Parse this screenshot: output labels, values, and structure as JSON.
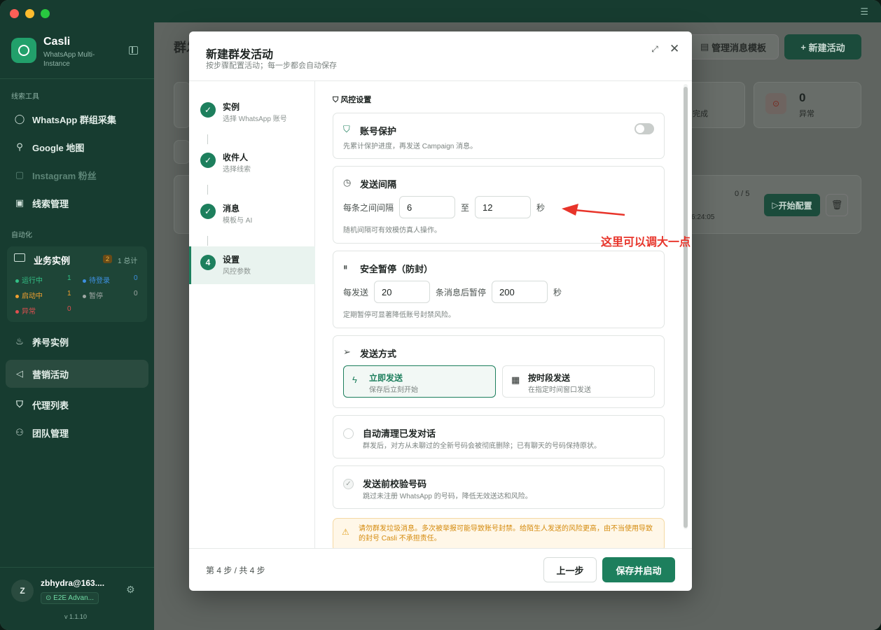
{
  "app": {
    "name": "Casli",
    "subtitle": "WhatsApp Multi-Instance"
  },
  "sidebar": {
    "section_leads": "线索工具",
    "section_auto": "自动化",
    "items_leads": [
      {
        "label": "WhatsApp 群组采集",
        "icon": "chat-bubble-icon"
      },
      {
        "label": "Google 地图",
        "icon": "map-pin-icon"
      },
      {
        "label": "Instagram 粉丝",
        "icon": "instagram-icon"
      },
      {
        "label": "线索管理",
        "icon": "contacts-icon"
      }
    ],
    "biz": {
      "title": "业务实例",
      "badge": "2",
      "total": "1 总计",
      "stats": [
        {
          "label": "运行中",
          "value": "1",
          "color": "#32c086"
        },
        {
          "label": "待登录",
          "value": "0",
          "color": "#3d8fe0"
        },
        {
          "label": "启动中",
          "value": "1",
          "color": "#f0a030"
        },
        {
          "label": "暂停",
          "value": "0",
          "color": "#a0a8a5"
        },
        {
          "label": "异常",
          "value": "0",
          "color": "#e05050"
        }
      ]
    },
    "items_auto": [
      {
        "label": "养号实例",
        "icon": "flame-icon"
      },
      {
        "label": "营销活动",
        "icon": "megaphone-icon"
      },
      {
        "label": "代理列表",
        "icon": "shield-icon"
      },
      {
        "label": "团队管理",
        "icon": "users-icon"
      }
    ],
    "user": {
      "initial": "Z",
      "name": "zbhydra@163....",
      "plan": "E2E Advan...",
      "version": "v 1.1.10"
    }
  },
  "bg": {
    "title": "群发",
    "btn_templates": "管理消息模板",
    "btn_new": "新建活动",
    "stat_done": "完成",
    "stat_error_value": "0",
    "stat_error_label": "异常",
    "progress": "0 / 5",
    "time": "6:24:05",
    "btn_config": "开始配置"
  },
  "modal": {
    "title": "新建群发活动",
    "subtitle": "按步骤配置活动；每一步都会自动保存",
    "steps": [
      {
        "num": "✓",
        "title": "实例",
        "sub": "选择 WhatsApp 账号"
      },
      {
        "num": "✓",
        "title": "收件人",
        "sub": "选择线索"
      },
      {
        "num": "✓",
        "title": "消息",
        "sub": "模板与 AI"
      },
      {
        "num": "4",
        "title": "设置",
        "sub": "风控参数"
      }
    ],
    "section": "风控设置",
    "protect": {
      "title": "账号保护",
      "desc": "先累计保护进度，再发送 Campaign 消息。",
      "enabled": false
    },
    "interval": {
      "title": "发送间隔",
      "label": "每条之间间隔",
      "min": "6",
      "to": "至",
      "max": "12",
      "unit": "秒",
      "desc": "随机间隔可有效模仿真人操作。"
    },
    "pause": {
      "title": "安全暂停（防封）",
      "label1": "每发送",
      "count": "20",
      "label2": "条消息后暂停",
      "seconds": "200",
      "unit": "秒",
      "desc": "定期暂停可显著降低账号封禁风险。"
    },
    "mode": {
      "title": "发送方式",
      "options": [
        {
          "title": "立即发送",
          "sub": "保存后立刻开始"
        },
        {
          "title": "按时段发送",
          "sub": "在指定时间窗口发送"
        }
      ]
    },
    "cleanup": {
      "title": "自动清理已发对话",
      "desc": "群发后，对方从未聊过的全新号码会被彻底删除；已有聊天的号码保持原状。"
    },
    "verify": {
      "title": "发送前校验号码",
      "desc": "跳过未注册 WhatsApp 的号码，降低无效送达和风险。"
    },
    "warning": "请勿群发垃圾消息。多次被举报可能导致账号封禁。给陌生人发送的风险更高，由不当使用导致的封号 Casli 不承担责任。",
    "page": "第 4 步 / 共 4 步",
    "prev": "上一步",
    "save": "保存并启动"
  },
  "annotation": {
    "text": "这里可以调大一点",
    "color": "#e8342a"
  }
}
